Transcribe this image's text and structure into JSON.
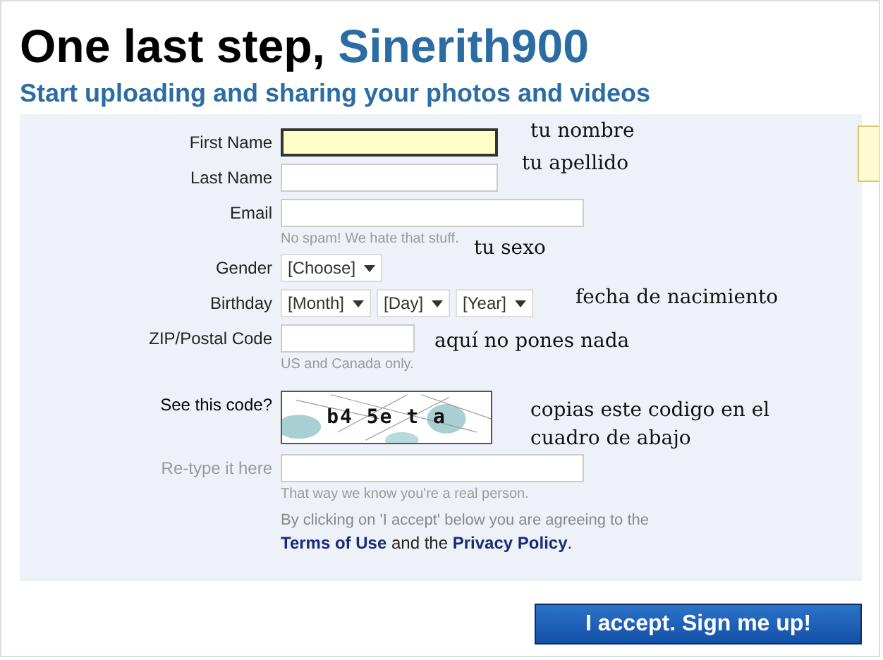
{
  "heading": {
    "title": "One last step, ",
    "username": "Sinerith900",
    "subtitle": "Start uploading and sharing your photos and videos"
  },
  "form": {
    "rows": [
      {
        "kind": "text",
        "label": "First Name",
        "focused": true,
        "note": "tu nombre"
      },
      {
        "kind": "text",
        "label": "Last Name",
        "focused": false,
        "note": "tu apellido"
      },
      {
        "kind": "text",
        "label": "Email",
        "focused": false,
        "hint": "No spam! We hate that stuff."
      },
      {
        "kind": "selects",
        "label": "Gender",
        "selects": [
          "[Choose]"
        ],
        "note": "tu sexo"
      },
      {
        "kind": "selects",
        "label": "Birthday",
        "selects": [
          "[Month]",
          "[Day]",
          "[Year]"
        ],
        "note": "fecha de nacimiento"
      },
      {
        "kind": "text",
        "label": "ZIP/Postal Code",
        "focused": false,
        "hint": "US and Canada only.",
        "note": "aquí no pones nada"
      },
      {
        "kind": "captcha",
        "label": "See this code?",
        "code": "b4 5e t a",
        "note": "copias este codigo en el cuadro de abajo"
      },
      {
        "kind": "text",
        "label": "Re-type it here",
        "focused": false,
        "hint": "That way we know you're a real person."
      }
    ],
    "agreement": {
      "text": "By clicking on 'I accept' below you are agreeing to the",
      "terms": "Terms of Use",
      "middle": " and the ",
      "privacy": "Privacy Policy",
      "end": "."
    }
  },
  "submit": "I accept. Sign me up!"
}
